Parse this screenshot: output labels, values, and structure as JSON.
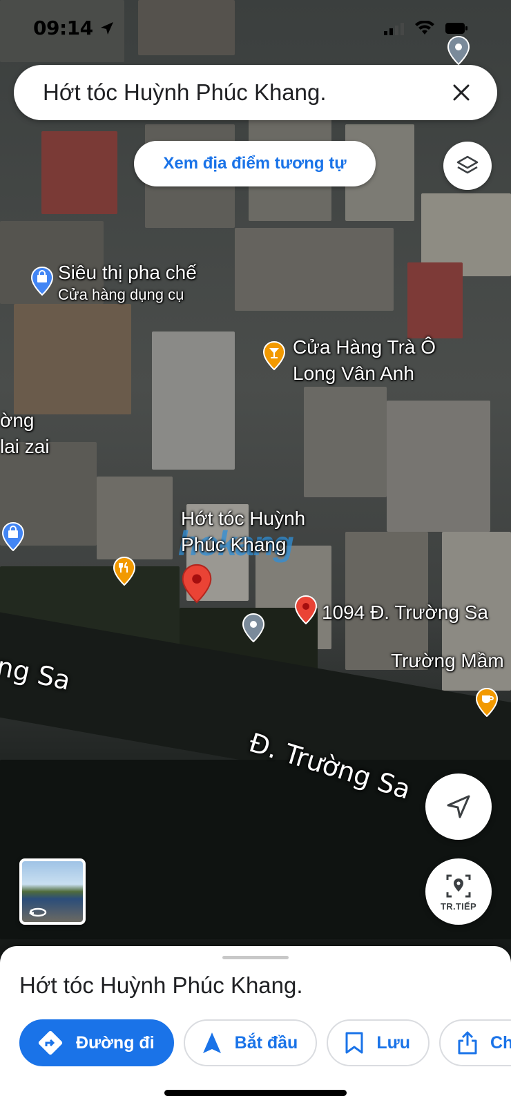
{
  "status_bar": {
    "time": "09:14"
  },
  "search": {
    "query": "Hớt tóc Huỳnh Phúc Khang."
  },
  "similar_places_label": "Xem địa điểm tương tự",
  "map": {
    "pois": [
      {
        "name": "Siêu thị pha chế",
        "category": "Cửa hàng dụng cụ",
        "icon": "shopping-bag-icon",
        "color": "#4285f4"
      },
      {
        "name_line1": "Cửa Hàng Trà Ô",
        "name_line2": "Long Vân Anh",
        "icon": "cocktail-icon",
        "color": "#f29900"
      },
      {
        "name_line1": "Hớt tóc Huỳnh",
        "name_line2": "Phúc Khang",
        "icon": "selected-place-pin-icon",
        "color": "#ea4335"
      },
      {
        "name": "1094 Đ. Trường Sa",
        "icon": "address-pin-icon",
        "color": "#ea4335"
      },
      {
        "name": "Trường Mầm",
        "icon": "coffee-icon",
        "color": "#f29900"
      },
      {
        "name_line1": "ờng",
        "name_line2": "lai zai"
      }
    ],
    "streets": [
      "Đ. Trường Sa",
      "ng Sa"
    ],
    "watermark": "hokang",
    "colors": {
      "blue_pin": "#4285f4",
      "orange_pin": "#f29900",
      "red_pin": "#ea4335",
      "gray_pin": "#7a8a9a"
    }
  },
  "controls": {
    "street_view_label": "TR.TIẾP"
  },
  "place_sheet": {
    "title": "Hớt tóc Huỳnh Phúc Khang.",
    "actions": {
      "directions": "Đường đi",
      "start": "Bắt đầu",
      "save": "Lưu",
      "share": "Ch"
    }
  },
  "accent_color": "#1a73e8"
}
